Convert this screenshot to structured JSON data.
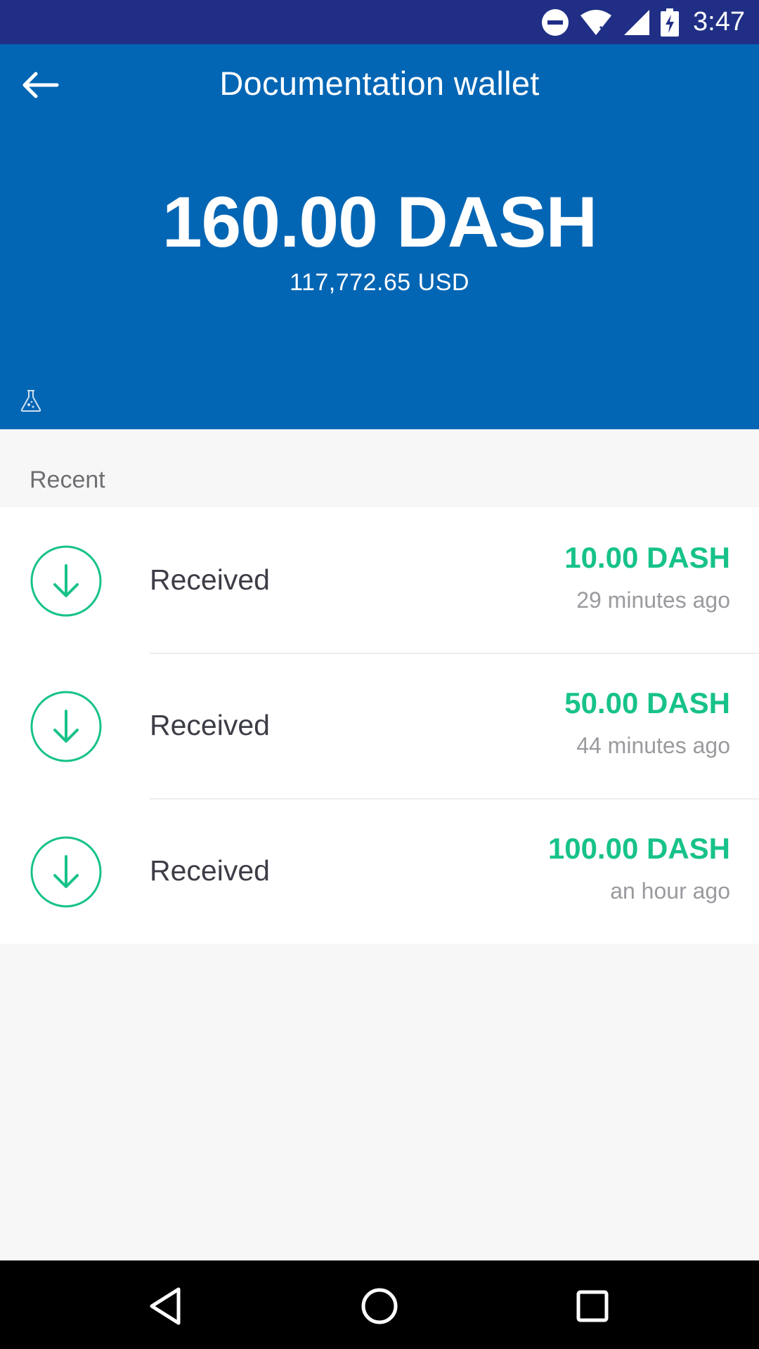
{
  "status_bar": {
    "time": "3:47",
    "icons": [
      "do-not-disturb-icon",
      "wifi-icon",
      "signal-icon",
      "battery-charging-icon"
    ]
  },
  "header": {
    "back_icon": "arrow-left-icon",
    "title": "Documentation wallet",
    "balance": "160.00 DASH",
    "balance_fiat": "117,772.65 USD",
    "network_icon": "flask-icon"
  },
  "recent": {
    "label": "Recent",
    "items": [
      {
        "label": "Received",
        "amount": "10.00 DASH",
        "time": "29 minutes ago",
        "icon": "arrow-down-circle-icon"
      },
      {
        "label": "Received",
        "amount": "50.00 DASH",
        "time": "44 minutes ago",
        "icon": "arrow-down-circle-icon"
      },
      {
        "label": "Received",
        "amount": "100.00 DASH",
        "time": "an hour ago",
        "icon": "arrow-down-circle-icon"
      }
    ]
  },
  "nav_bar": {
    "icons": [
      "back-triangle-icon",
      "home-circle-icon",
      "recents-square-icon"
    ]
  },
  "colors": {
    "status_bar": "#202f85",
    "header": "#0366b4",
    "received": "#17c28a",
    "background": "#f7f7f7"
  }
}
